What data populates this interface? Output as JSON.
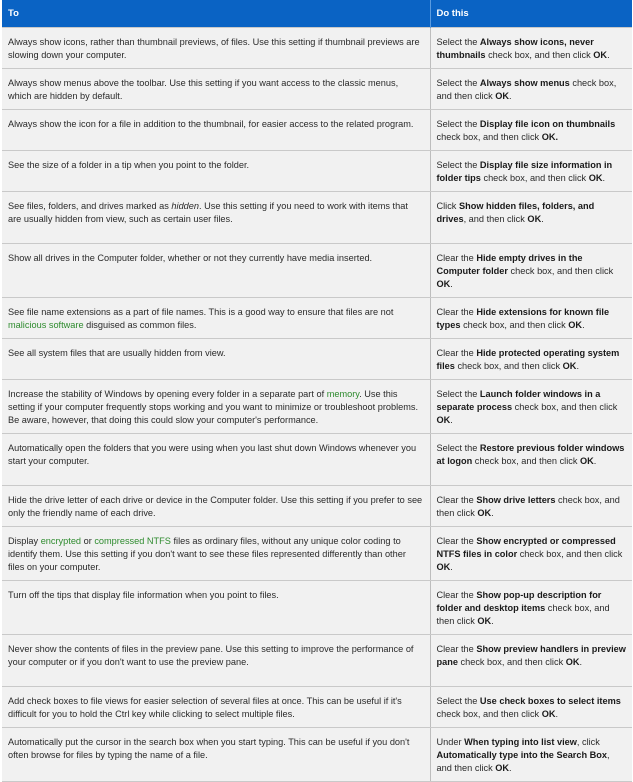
{
  "header": {
    "col_to": "To",
    "col_do": "Do this"
  },
  "colors": {
    "header_bg": "#0a63c4",
    "row_bg": "#f1f1f1",
    "link": "#2e8b2e"
  },
  "rows": [
    {
      "to": [
        {
          "t": "Always show icons, rather than thumbnail previews, of files. Use this setting if thumbnail previews are slowing down your computer."
        }
      ],
      "do": [
        {
          "t": "Select the "
        },
        {
          "t": "Always show icons, never thumbnails",
          "b": true
        },
        {
          "t": " check box, and then click "
        },
        {
          "t": "OK",
          "b": true
        },
        {
          "t": "."
        }
      ]
    },
    {
      "to": [
        {
          "t": "Always show menus above the toolbar. Use this setting if you want access to the classic menus, which are hidden by default."
        }
      ],
      "do": [
        {
          "t": "Select the "
        },
        {
          "t": "Always show menus",
          "b": true
        },
        {
          "t": " check box, and then click "
        },
        {
          "t": "OK",
          "b": true
        },
        {
          "t": "."
        }
      ]
    },
    {
      "to": [
        {
          "t": "Always show the icon for a file in addition to the thumbnail, for easier access to the related program."
        }
      ],
      "do": [
        {
          "t": "Select the "
        },
        {
          "t": "Display file icon on thumbnails",
          "b": true
        },
        {
          "t": " check box, and then click "
        },
        {
          "t": "OK.",
          "b": true
        }
      ]
    },
    {
      "to": [
        {
          "t": "See the size of a folder in a tip when you point to the folder."
        }
      ],
      "do": [
        {
          "t": "Select the "
        },
        {
          "t": "Display file size information in folder tips",
          "b": true
        },
        {
          "t": " check box, and then click "
        },
        {
          "t": "OK",
          "b": true
        },
        {
          "t": "."
        }
      ]
    },
    {
      "to": [
        {
          "t": "See files, folders, and drives marked as "
        },
        {
          "t": "hidden",
          "i": true
        },
        {
          "t": ". Use this setting if you need to work with items that are usually hidden from view, such as certain user files."
        }
      ],
      "do": [
        {
          "t": "Click "
        },
        {
          "t": "Show hidden files, folders, and drives",
          "b": true
        },
        {
          "t": ", and then click "
        },
        {
          "t": "OK",
          "b": true
        },
        {
          "t": "."
        }
      ]
    },
    {
      "to": [
        {
          "t": "Show all drives in the Computer folder, whether or not they currently have media inserted."
        }
      ],
      "do": [
        {
          "t": "Clear the "
        },
        {
          "t": "Hide empty drives in the Computer folder",
          "b": true
        },
        {
          "t": " check box, and then click "
        },
        {
          "t": "OK",
          "b": true
        },
        {
          "t": "."
        }
      ]
    },
    {
      "to": [
        {
          "t": "See file name extensions as a part of file names. This is a good way to ensure that files are not "
        },
        {
          "t": "malicious software",
          "l": true
        },
        {
          "t": " disguised as common files."
        }
      ],
      "do": [
        {
          "t": "Clear the "
        },
        {
          "t": "Hide extensions for known file types",
          "b": true
        },
        {
          "t": " check box, and then click "
        },
        {
          "t": "OK",
          "b": true
        },
        {
          "t": "."
        }
      ]
    },
    {
      "to": [
        {
          "t": "See all system files that are usually hidden from view."
        }
      ],
      "do": [
        {
          "t": "Clear the "
        },
        {
          "t": "Hide protected operating system files",
          "b": true
        },
        {
          "t": " check box, and then click "
        },
        {
          "t": "OK",
          "b": true
        },
        {
          "t": "."
        }
      ]
    },
    {
      "to": [
        {
          "t": "Increase the stability of Windows by opening every folder in a separate part of "
        },
        {
          "t": "memory",
          "l": true
        },
        {
          "t": ". Use this setting if your computer frequently stops working and you want to minimize or troubleshoot problems. Be aware, however, that doing this could slow your computer's performance."
        }
      ],
      "do": [
        {
          "t": "Select the "
        },
        {
          "t": "Launch folder windows in a separate process",
          "b": true
        },
        {
          "t": " check box, and then click "
        },
        {
          "t": "OK",
          "b": true
        },
        {
          "t": "."
        }
      ]
    },
    {
      "to": [
        {
          "t": "Automatically open the folders that you were using when you last shut down Windows whenever you start your computer."
        }
      ],
      "do": [
        {
          "t": "Select the "
        },
        {
          "t": "Restore previous folder windows at logon",
          "b": true
        },
        {
          "t": " check box, and then click "
        },
        {
          "t": "OK",
          "b": true
        },
        {
          "t": "."
        }
      ]
    },
    {
      "to": [
        {
          "t": "Hide the drive letter of each drive or device in the Computer folder. Use this setting if you prefer to see only the friendly name of each drive."
        }
      ],
      "do": [
        {
          "t": "Clear the "
        },
        {
          "t": "Show drive letters",
          "b": true
        },
        {
          "t": " check box, and then click "
        },
        {
          "t": "OK",
          "b": true
        },
        {
          "t": "."
        }
      ]
    },
    {
      "to": [
        {
          "t": "Display "
        },
        {
          "t": "encrypted",
          "l": true
        },
        {
          "t": " or "
        },
        {
          "t": "compressed NTFS",
          "l": true
        },
        {
          "t": " files as ordinary files, without any unique color coding to identify them. Use this setting if you don't want to see these files represented differently than other files on your computer."
        }
      ],
      "do": [
        {
          "t": "Clear the "
        },
        {
          "t": "Show encrypted or compressed NTFS files in color",
          "b": true
        },
        {
          "t": " check box, and then click "
        },
        {
          "t": "OK",
          "b": true
        },
        {
          "t": "."
        }
      ]
    },
    {
      "to": [
        {
          "t": "Turn off the tips that display file information when you point to files."
        }
      ],
      "do": [
        {
          "t": "Clear the "
        },
        {
          "t": "Show pop-up description for folder and desktop items",
          "b": true
        },
        {
          "t": " check box, and then click "
        },
        {
          "t": "OK",
          "b": true
        },
        {
          "t": "."
        }
      ]
    },
    {
      "to": [
        {
          "t": "Never show the contents of files in the preview pane. Use this setting to improve the performance of your computer or if you don't want to use the preview pane."
        }
      ],
      "do": [
        {
          "t": "Clear the "
        },
        {
          "t": "Show preview handlers in preview pane",
          "b": true
        },
        {
          "t": " check box, and then click "
        },
        {
          "t": "OK",
          "b": true
        },
        {
          "t": "."
        }
      ]
    },
    {
      "to": [
        {
          "t": "Add check boxes to file views for easier selection of several files at once. This can be useful if it's difficult for you to hold the Ctrl key while clicking to select multiple files."
        }
      ],
      "do": [
        {
          "t": "Select the "
        },
        {
          "t": "Use check boxes to select items",
          "b": true
        },
        {
          "t": " check box, and then click "
        },
        {
          "t": "OK",
          "b": true
        },
        {
          "t": "."
        }
      ]
    },
    {
      "to": [
        {
          "t": "Automatically put the cursor in the search box when you start typing. This can be useful if you don't often browse for files by typing the name of a file."
        }
      ],
      "do": [
        {
          "t": "Under "
        },
        {
          "t": "When typing into list view",
          "b": true
        },
        {
          "t": ", click "
        },
        {
          "t": "Automatically type into the Search Box",
          "b": true
        },
        {
          "t": ", and then click "
        },
        {
          "t": "OK",
          "b": true
        },
        {
          "t": "."
        }
      ]
    }
  ]
}
